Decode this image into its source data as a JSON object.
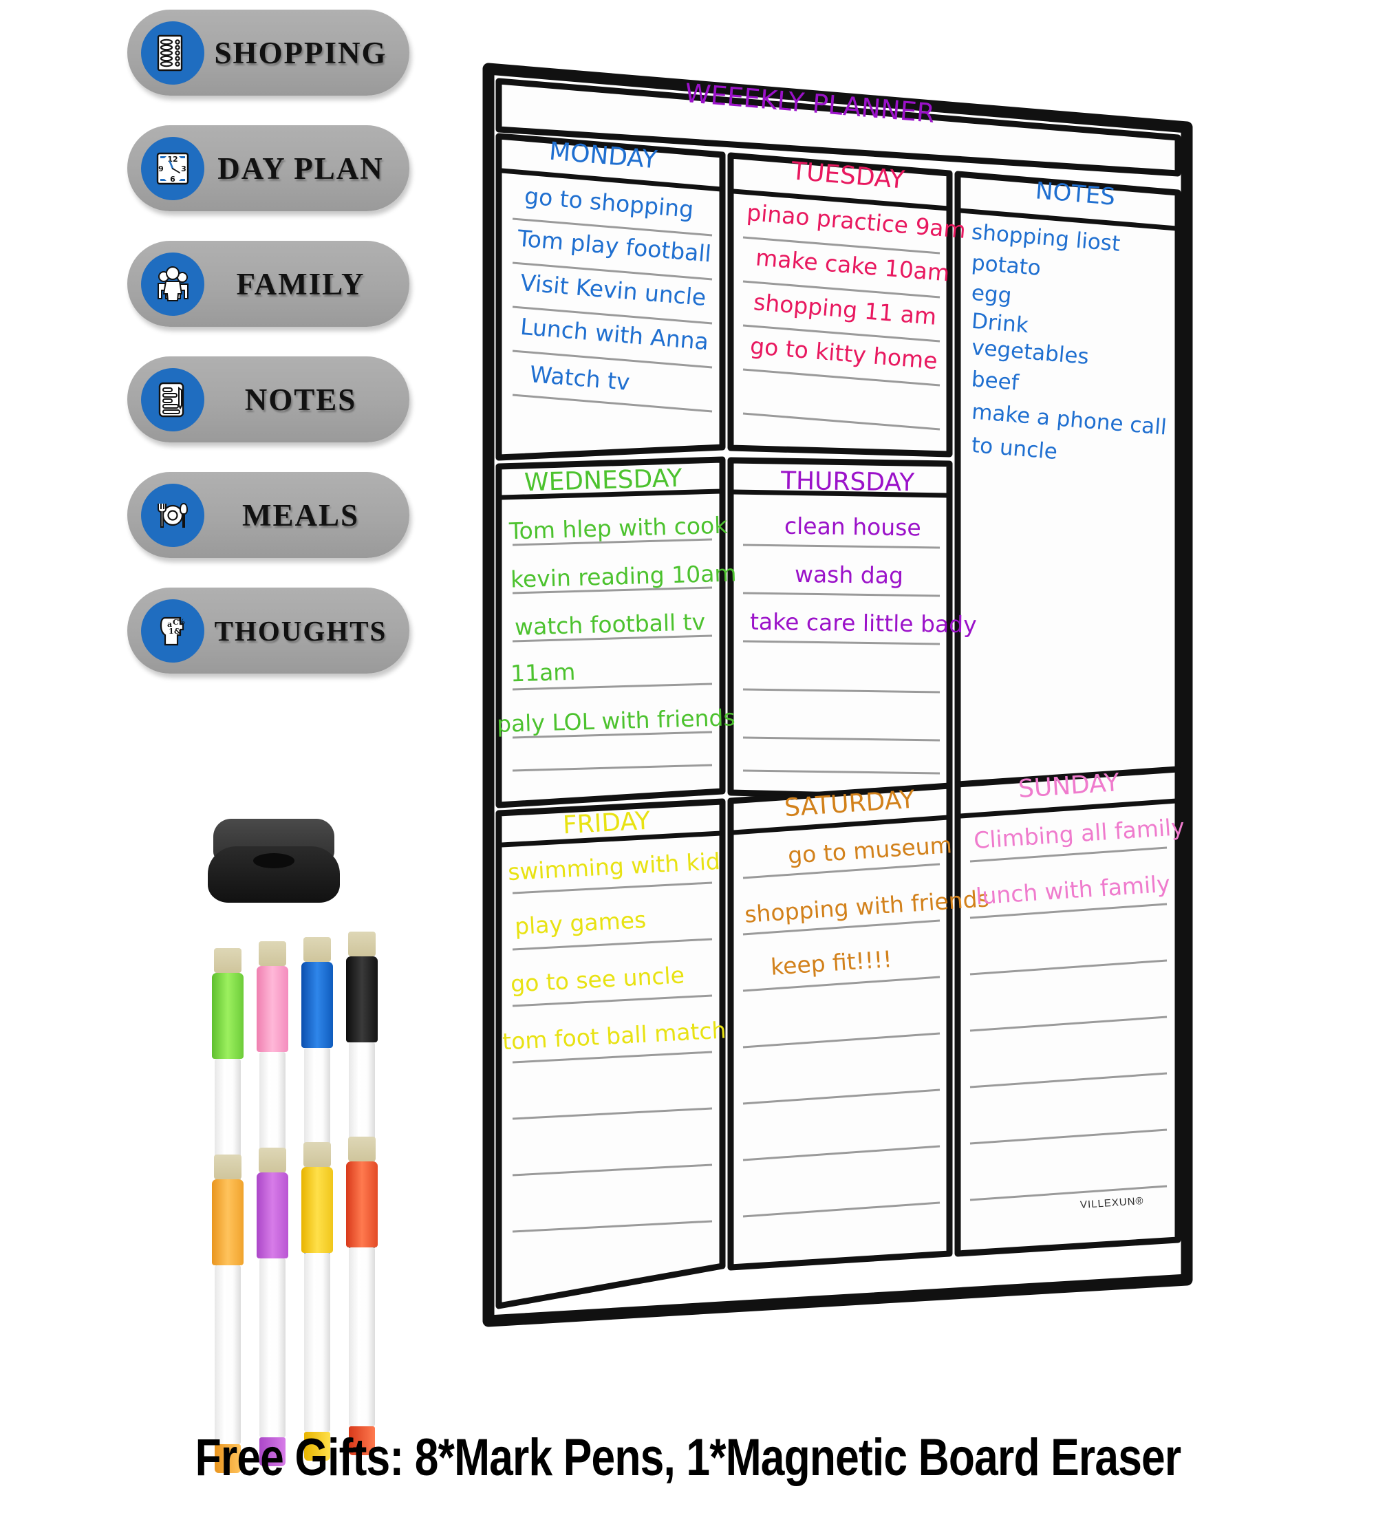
{
  "magnets": [
    {
      "label": "SHOPPING",
      "icon": "shopping-list-icon"
    },
    {
      "label": "DAY PLAN",
      "icon": "clock-icon"
    },
    {
      "label": "FAMILY",
      "icon": "family-icon"
    },
    {
      "label": "NOTES",
      "icon": "note-pencil-icon"
    },
    {
      "label": "MEALS",
      "icon": "cutlery-plate-icon"
    },
    {
      "label": "THOUGHTS",
      "icon": "head-symbols-icon"
    }
  ],
  "board": {
    "title": "WEEEKLY PLANNER",
    "title_color": "#9b12c9",
    "brand": "VILLEXUN®",
    "days": [
      {
        "name": "MONDAY",
        "color": "#1f6fd0",
        "entries": [
          "go to shopping",
          "Tom play football",
          "Visit Kevin uncle",
          "Lunch with Anna",
          "Watch tv"
        ]
      },
      {
        "name": "TUESDAY",
        "color": "#e8185f",
        "entries": [
          "pinao practice 9am",
          "make cake 10am",
          "shopping 11 am",
          "go to kitty home"
        ]
      },
      {
        "name": "WEDNESDAY",
        "color": "#4cc22e",
        "entries": [
          "Tom hlep with cook",
          "kevin reading 10am",
          "watch football tv",
          "11am",
          "paly LOL with friends"
        ]
      },
      {
        "name": "THURSDAY",
        "color": "#9b12c9",
        "entries": [
          "clean house",
          "wash dag",
          "take care little bady"
        ]
      },
      {
        "name": "FRIDAY",
        "color": "#e8e212",
        "entries": [
          "swimming with kid",
          "play games",
          "go to see uncle",
          "tom foot ball match"
        ]
      },
      {
        "name": "SATURDAY",
        "color": "#d2811b",
        "entries": [
          "go to museum",
          "shopping with friends",
          "keep fit!!!!"
        ]
      },
      {
        "name": "SUNDAY",
        "color": "#ef7bcd",
        "entries": [
          "Climbing all family",
          "lunch with family"
        ]
      }
    ],
    "notes": {
      "name": "NOTES",
      "color": "#1f6fd0",
      "lines": [
        "shopping liost",
        "potato",
        "egg",
        "Drink",
        "vegetables",
        "beef",
        "",
        "make a phone call",
        "to uncle"
      ]
    }
  },
  "accessories": {
    "eraser": "magnetic-board-eraser",
    "pens": [
      {
        "color": "#7ee04a",
        "name": "green-marker"
      },
      {
        "color": "#ff9ecb",
        "name": "pink-marker"
      },
      {
        "color": "#1464d8",
        "name": "blue-marker"
      },
      {
        "color": "#1a1a1a",
        "name": "black-marker"
      },
      {
        "color": "#fbb03b",
        "name": "orange-marker"
      },
      {
        "color": "#cc63e0",
        "name": "purple-marker"
      },
      {
        "color": "#ffd21e",
        "name": "yellow-marker"
      },
      {
        "color": "#f2542a",
        "name": "red-marker"
      }
    ]
  },
  "caption": "Free Gifts: 8*Mark Pens, 1*Magnetic Board Eraser"
}
